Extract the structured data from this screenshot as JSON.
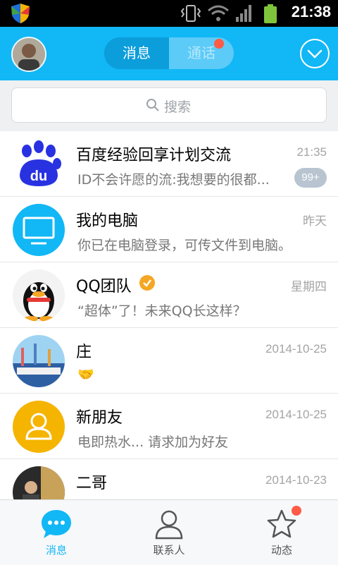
{
  "status_bar": {
    "time": "21:38"
  },
  "header": {
    "tabs": [
      {
        "label": "消息",
        "active": true
      },
      {
        "label": "通话",
        "active": false,
        "has_dot": true
      }
    ]
  },
  "search": {
    "placeholder": "搜索"
  },
  "conversations": [
    {
      "name": "百度经验回享计划交流",
      "time": "21:35",
      "message": "ID不会许愿的流:我想要的很都...",
      "badge": "99+",
      "avatar": "baidu-logo"
    },
    {
      "name": "我的电脑",
      "time": "昨天",
      "message": "你已在电脑登录，可传文件到电脑。",
      "avatar": "monitor-icon"
    },
    {
      "name": "QQ团队",
      "time": "星期四",
      "message": "“超体”了！未来QQ长这样？",
      "verified": true,
      "avatar": "qq-penguin"
    },
    {
      "name": "庄",
      "time": "2014-10-25",
      "message": "🤝",
      "avatar": "photo"
    },
    {
      "name": "新朋友",
      "time": "2014-10-25",
      "message": "电即热水... 请求加为好友",
      "avatar": "person-icon"
    },
    {
      "name": "二哥",
      "time": "2014-10-23",
      "message": "",
      "avatar": "photo"
    }
  ],
  "tabbar": {
    "items": [
      {
        "label": "消息",
        "active": true
      },
      {
        "label": "联系人",
        "active": false
      },
      {
        "label": "动态",
        "active": false,
        "has_dot": true
      }
    ]
  },
  "colors": {
    "accent": "#12b7f5",
    "badge": "#b8c5d0",
    "notify_dot": "#ff5b45",
    "verified": "#f5a623"
  }
}
